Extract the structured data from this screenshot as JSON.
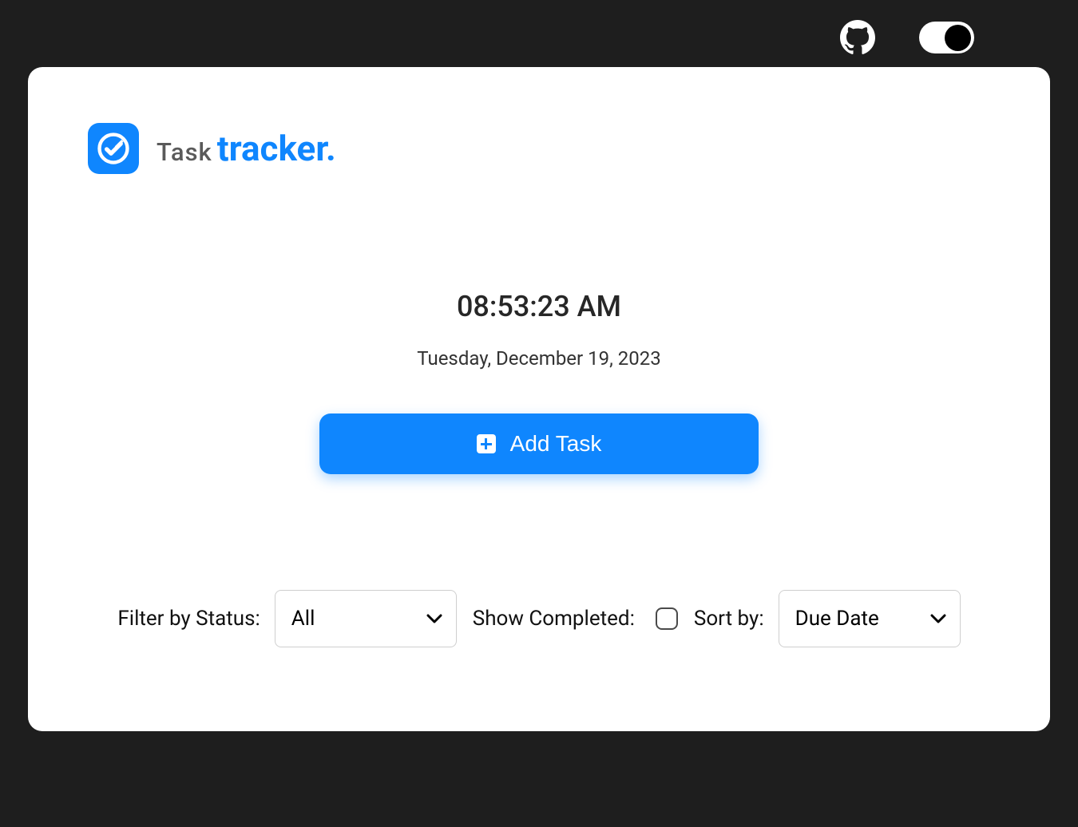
{
  "header": {
    "logo_alt": "check-circle",
    "title_prefix": "Task",
    "title_suffix": "tracker."
  },
  "clock": {
    "time": "08:53:23 AM",
    "date": "Tuesday, December 19, 2023"
  },
  "add_task_label": "Add Task",
  "filters": {
    "filter_label": "Filter by Status:",
    "filter_value": "All",
    "show_completed_label": "Show Completed:",
    "show_completed_checked": false,
    "sort_label": "Sort by:",
    "sort_value": "Due Date"
  },
  "colors": {
    "accent": "#0f86fe",
    "background_dark": "#1e1e1e"
  }
}
